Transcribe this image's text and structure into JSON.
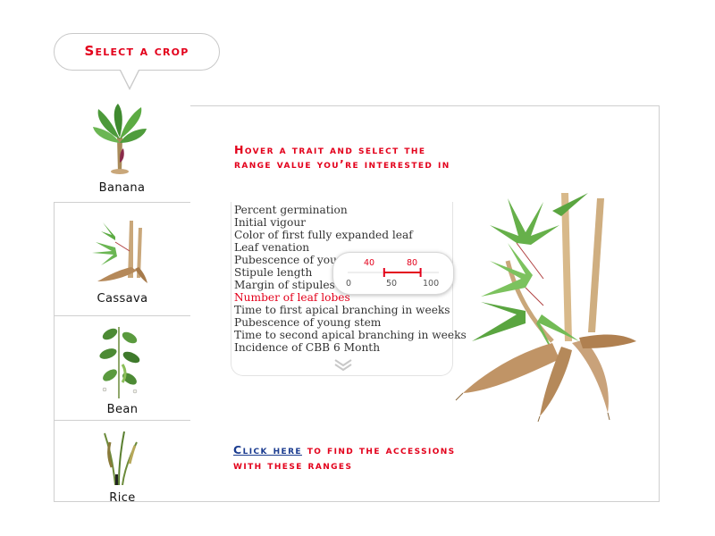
{
  "header": {
    "title": "Select a crop"
  },
  "crops": [
    {
      "label": "Banana",
      "icon": "banana-plant-icon",
      "active": true
    },
    {
      "label": "Cassava",
      "icon": "cassava-plant-icon",
      "active": false
    },
    {
      "label": "Bean",
      "icon": "bean-plant-icon",
      "active": false
    },
    {
      "label": "Rice",
      "icon": "rice-plant-icon",
      "active": false
    }
  ],
  "instructions": {
    "line1": "Hover a trait and select the",
    "line2": "range value you’re interested in"
  },
  "traits": [
    "Percent germination",
    "Initial vigour",
    "Color of first fully expanded leaf",
    "Leaf venation",
    "Pubescence of young l",
    "Stipule length",
    "Margin of stipules",
    "Number of leaf lobes",
    "Time to first apical branching in weeks",
    "Pubescence of young stem",
    "Time to second apical branching in weeks",
    "Incidence of CBB 6 Month"
  ],
  "selected_trait": "Number of leaf lobes",
  "range_slider": {
    "low": "40",
    "high": "80",
    "min_label": "0",
    "mid_label": "50",
    "max_label": "100",
    "selected_min": 40,
    "selected_max": 80,
    "scale_min": 0,
    "scale_max": 100
  },
  "cta": {
    "link_text": "Click here",
    "rest_line1": " to find the accessions",
    "line2": "with these ranges"
  },
  "colors": {
    "accent": "#e3001b",
    "link": "#1a3b8f",
    "border": "#cfcfcf"
  }
}
